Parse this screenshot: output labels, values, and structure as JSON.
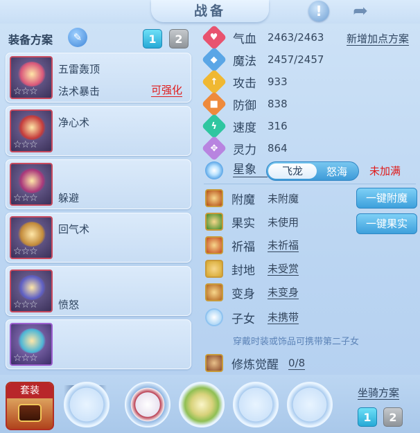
{
  "header": {
    "title": "战备",
    "alert_glyph": "!",
    "share_glyph": "➦"
  },
  "left": {
    "plan_label": "装备方案",
    "edit_glyph": "✎",
    "pages": [
      "1",
      "2"
    ],
    "equipment": [
      {
        "line1": "五雷轰顶",
        "line2": "法术暴击",
        "upgrade": "可强化",
        "stars": "☆☆☆",
        "art": "#d9577a"
      },
      {
        "line1": "净心术",
        "line2": "",
        "upgrade": "",
        "stars": "☆☆☆",
        "art": "#c43b3b"
      },
      {
        "line1": "",
        "line2": "躲避",
        "upgrade": "",
        "stars": "☆☆☆",
        "art": "#a9377a"
      },
      {
        "line1": "回气术",
        "line2": "",
        "upgrade": "",
        "stars": "☆☆☆",
        "art": "#c28a3a"
      },
      {
        "line1": "",
        "line2": "愤怒",
        "upgrade": "",
        "stars": "☆☆☆",
        "art": "#5e5fc4"
      },
      {
        "line1": "",
        "line2": "",
        "upgrade": "",
        "stars": "☆☆☆",
        "art": "#4db6d6"
      }
    ]
  },
  "stats": {
    "add_points_label": "新增加点方案",
    "rows": [
      {
        "name": "气血",
        "value": "2463/2463",
        "color": "#e8536f",
        "glyph": "♥"
      },
      {
        "name": "魔法",
        "value": "2457/2457",
        "color": "#5aa6e6",
        "glyph": "◆"
      },
      {
        "name": "攻击",
        "value": "933",
        "color": "#f0b832",
        "glyph": "↑"
      },
      {
        "name": "防御",
        "value": "838",
        "color": "#ee8a3c",
        "glyph": "■"
      },
      {
        "name": "速度",
        "value": "316",
        "color": "#2fc6a0",
        "glyph": "ϟ"
      },
      {
        "name": "灵力",
        "value": "864",
        "color": "#b884e0",
        "glyph": "✥"
      }
    ],
    "star_sign": {
      "name": "星象",
      "option_on": "飞龙",
      "option_off": "怒海",
      "status": "未加满"
    }
  },
  "attrs": {
    "rows": [
      {
        "name": "附魔",
        "value": "未附魔",
        "underline": false,
        "color": "#b34a12"
      },
      {
        "name": "果实",
        "value": "未使用",
        "underline": false,
        "color": "#3e8a2a"
      },
      {
        "name": "祈福",
        "value": "未祈福",
        "underline": true,
        "color": "#c44a1f"
      },
      {
        "name": "封地",
        "value": "未受赏",
        "underline": true,
        "color": "#d4a52b"
      },
      {
        "name": "变身",
        "value": "未变身",
        "underline": true,
        "color": "#b3651f"
      },
      {
        "name": "子女",
        "value": "未携带",
        "underline": true,
        "color": "#4fa3e6"
      }
    ],
    "onekey_enchant": "一键附魔",
    "onekey_fruit": "一键果实",
    "child_hint": "穿戴时装或饰品可携带第二子女",
    "cultivation": {
      "name": "修炼觉醒",
      "value": "0/8"
    }
  },
  "bottom": {
    "set_label": "套装",
    "soul_label": "魂技",
    "mount_label": "坐骑方案",
    "mount_pages": [
      "1",
      "2"
    ]
  }
}
